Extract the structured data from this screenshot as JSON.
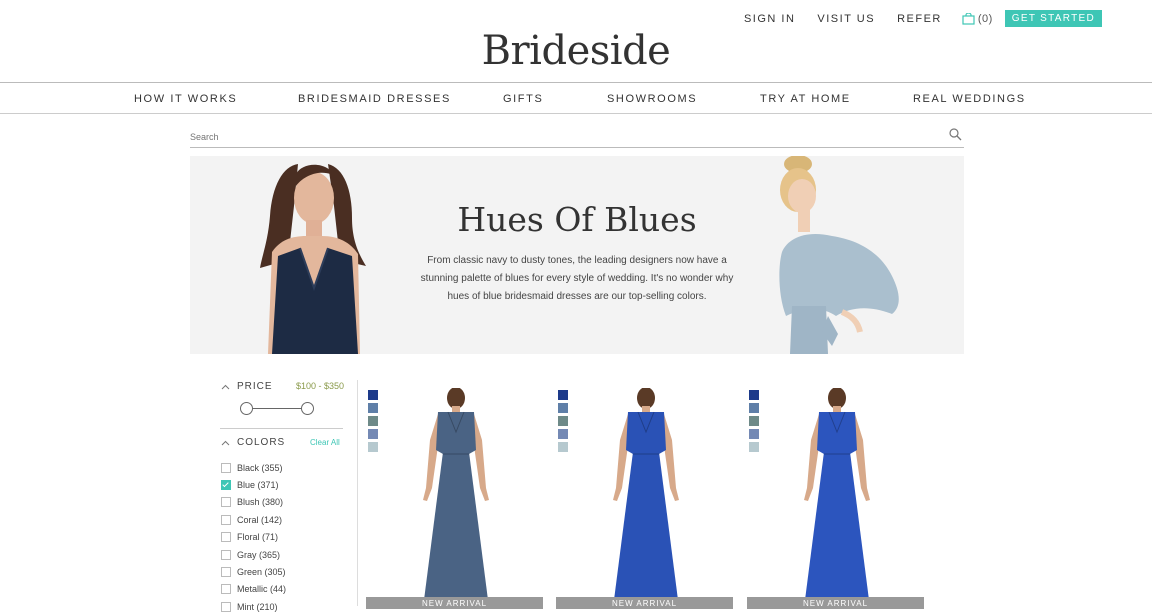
{
  "header": {
    "links": [
      "SIGN IN",
      "VISIT US",
      "REFER"
    ],
    "cart_count": "(0)",
    "cta": "GET STARTED",
    "logo": "Brideside"
  },
  "nav": [
    "HOW IT WORKS",
    "BRIDESMAID DRESSES",
    "GIFTS",
    "SHOWROOMS",
    "TRY AT HOME",
    "REAL WEDDINGS"
  ],
  "search": {
    "placeholder": "Search"
  },
  "banner": {
    "title": "Hues Of Blues",
    "text": "From classic navy to dusty tones, the leading designers now have a stunning palette of blues for every style of wedding. It's no wonder why hues of blue bridesmaid dresses are our top-selling colors."
  },
  "filters": {
    "price": {
      "label": "PRICE",
      "range": "$100 - $350"
    },
    "colors": {
      "label": "COLORS",
      "clear": "Clear All",
      "items": [
        {
          "label": "Black (355)",
          "checked": false
        },
        {
          "label": "Blue (371)",
          "checked": true
        },
        {
          "label": "Blush (380)",
          "checked": false
        },
        {
          "label": "Coral (142)",
          "checked": false
        },
        {
          "label": "Floral (71)",
          "checked": false
        },
        {
          "label": "Gray (365)",
          "checked": false
        },
        {
          "label": "Green (305)",
          "checked": false
        },
        {
          "label": "Metallic (44)",
          "checked": false
        },
        {
          "label": "Mint (210)",
          "checked": false
        }
      ]
    }
  },
  "products": [
    {
      "badge": "NEW ARRIVAL",
      "dress_color": "#4a6384",
      "swatches": [
        "#1d3a8a",
        "#5f7fa8",
        "#6e8a88",
        "#7489b4",
        "#b6c9cf"
      ]
    },
    {
      "badge": "NEW ARRIVAL",
      "dress_color": "#2a52b6",
      "swatches": [
        "#1d3a8a",
        "#5f7fa8",
        "#6e8a88",
        "#7489b4",
        "#b6c9cf"
      ]
    },
    {
      "badge": "NEW ARRIVAL",
      "dress_color": "#2c55be",
      "swatches": [
        "#1d3a8a",
        "#5f7fa8",
        "#6e8a88",
        "#7489b4",
        "#b6c9cf"
      ]
    }
  ],
  "colors": {
    "accent": "#3ec6b5",
    "price": "#8a9a4a"
  }
}
